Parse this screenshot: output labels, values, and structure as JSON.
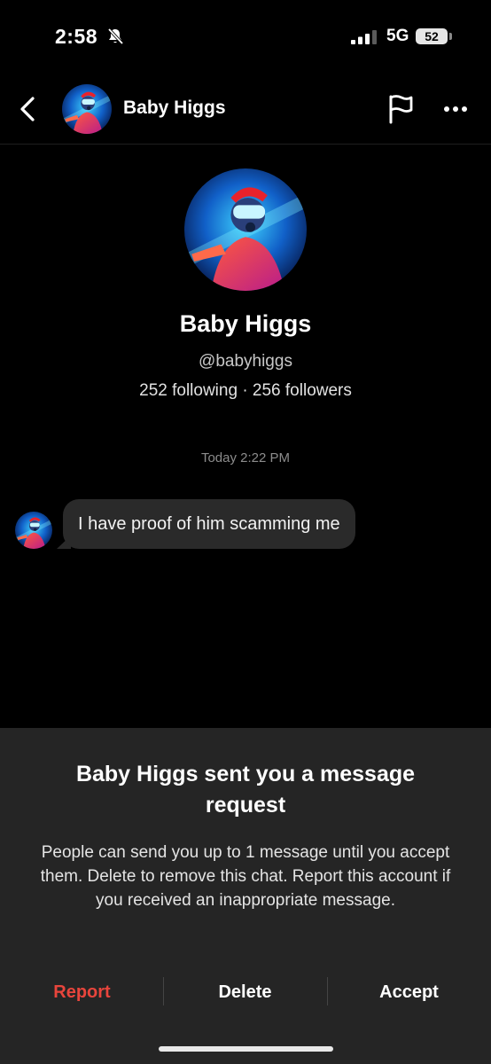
{
  "status_bar": {
    "time": "2:58",
    "network": "5G",
    "battery": "52"
  },
  "header": {
    "name": "Baby Higgs",
    "avatar_icon": "profile-avatar-image"
  },
  "profile": {
    "name": "Baby Higgs",
    "handle": "@babyhiggs",
    "stats": "252 following · 256 followers"
  },
  "conversation": {
    "timestamp": "Today 2:22 PM",
    "messages": [
      {
        "text": "I have proof of him scamming me"
      }
    ]
  },
  "request_sheet": {
    "title": "Baby Higgs sent you a message request",
    "body": "People can send you up to 1 message until you accept them. Delete to remove this chat. Report this account if you received an inappropriate message.",
    "actions": {
      "report": "Report",
      "delete": "Delete",
      "accept": "Accept"
    }
  },
  "colors": {
    "background": "#000000",
    "sheet": "#252525",
    "bubble": "#2a2a2a",
    "report": "#e8453c"
  }
}
